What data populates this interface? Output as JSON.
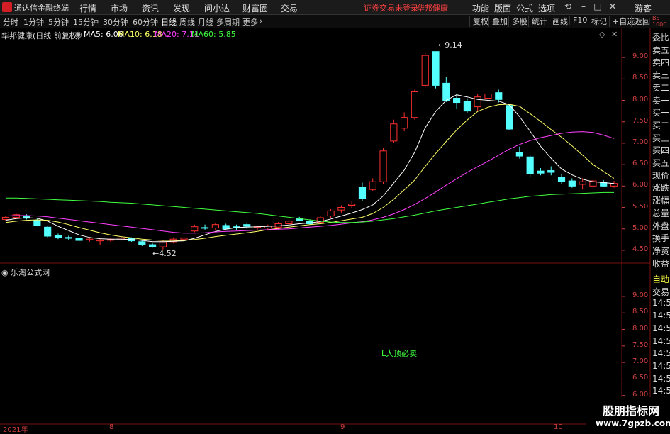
{
  "topbar": {
    "app_title": "通达信金融终端",
    "menu": [
      "行情",
      "市场",
      "资讯",
      "发现",
      "问小达",
      "财富圈",
      "交易"
    ],
    "notice": "证券交易未登录",
    "stock_name_header": "华邦健康",
    "tools": [
      "功能",
      "版面",
      "公式",
      "选项"
    ],
    "user": "游客"
  },
  "periodbar": {
    "periods": [
      "分时",
      "1分钟",
      "5分钟",
      "15分钟",
      "30分钟",
      "60分钟",
      "日线",
      "周线",
      "月线",
      "多周期",
      "更多"
    ],
    "active_period": "日线",
    "right_buttons": [
      "复权",
      "叠加",
      "多股",
      "统计",
      "画线",
      "F10",
      "标记",
      "+自选",
      "返回"
    ]
  },
  "main_chart": {
    "stock_label": "华邦健康(日线 前复权)",
    "ma": [
      {
        "label": "MA5: 6.06",
        "color": "#ffffff"
      },
      {
        "label": "MA10: 6.18",
        "color": "#ffff66"
      },
      {
        "label": "MA20: 7.11",
        "color": "#ff40ff"
      },
      {
        "label": "MA60: 5.85",
        "color": "#40ff40"
      }
    ],
    "high_label": "9.14",
    "low_label": "4.52"
  },
  "sub_chart": {
    "title": "乐淘公式网",
    "signal_text": "L大顶必卖"
  },
  "right_panel_top": [
    "B",
    "S",
    "1000"
  ],
  "right_panel_labels": [
    "委比",
    "卖五",
    "卖四",
    "卖三",
    "卖二",
    "卖一",
    "买一",
    "买二",
    "买三",
    "买四",
    "买五",
    "现价",
    "涨跌",
    "涨幅",
    "总量",
    "外盘",
    "换手",
    "净资",
    "收益"
  ],
  "right_panel_lower": [
    "自动",
    "交易",
    "14:56",
    "14:56",
    "14:56",
    "14:56",
    "14:56",
    "14:56",
    "14:56",
    "14:56",
    "14:56",
    "14:56"
  ],
  "x_labels": [
    "2021年",
    "8",
    "9",
    "10"
  ],
  "watermark": {
    "text": "股朋指标网",
    "url": "www.7gpzb.com"
  },
  "chart_data": [
    {
      "type": "candlestick",
      "title": "华邦健康(日线 前复权)",
      "ylim": [
        4.3,
        9.35
      ],
      "y_ticks": [
        9.0,
        8.5,
        8.0,
        7.5,
        7.0,
        6.5,
        6.0,
        5.5,
        5.0,
        4.5
      ],
      "candles": [
        {
          "o": 5.22,
          "h": 5.3,
          "l": 5.18,
          "c": 5.27
        },
        {
          "o": 5.27,
          "h": 5.36,
          "l": 5.24,
          "c": 5.33
        },
        {
          "o": 5.3,
          "h": 5.34,
          "l": 5.22,
          "c": 5.25
        },
        {
          "o": 5.2,
          "h": 5.25,
          "l": 5.06,
          "c": 5.08
        },
        {
          "o": 5.04,
          "h": 5.08,
          "l": 4.8,
          "c": 4.83
        },
        {
          "o": 4.84,
          "h": 4.89,
          "l": 4.76,
          "c": 4.8
        },
        {
          "o": 4.8,
          "h": 4.84,
          "l": 4.74,
          "c": 4.78
        },
        {
          "o": 4.78,
          "h": 4.82,
          "l": 4.7,
          "c": 4.73
        },
        {
          "o": 4.74,
          "h": 4.78,
          "l": 4.7,
          "c": 4.76
        },
        {
          "o": 4.72,
          "h": 4.76,
          "l": 4.62,
          "c": 4.74
        },
        {
          "o": 4.74,
          "h": 4.79,
          "l": 4.7,
          "c": 4.75
        },
        {
          "o": 4.76,
          "h": 4.82,
          "l": 4.72,
          "c": 4.79
        },
        {
          "o": 4.78,
          "h": 4.8,
          "l": 4.7,
          "c": 4.72
        },
        {
          "o": 4.7,
          "h": 4.74,
          "l": 4.6,
          "c": 4.64
        },
        {
          "o": 4.63,
          "h": 4.66,
          "l": 4.56,
          "c": 4.59
        },
        {
          "o": 4.58,
          "h": 4.72,
          "l": 4.52,
          "c": 4.7
        },
        {
          "o": 4.7,
          "h": 4.8,
          "l": 4.66,
          "c": 4.76
        },
        {
          "o": 4.76,
          "h": 4.84,
          "l": 4.7,
          "c": 4.79
        },
        {
          "o": 4.95,
          "h": 5.1,
          "l": 4.92,
          "c": 5.05
        },
        {
          "o": 5.03,
          "h": 5.1,
          "l": 4.98,
          "c": 5.02
        },
        {
          "o": 5.02,
          "h": 5.14,
          "l": 4.96,
          "c": 5.1
        },
        {
          "o": 5.08,
          "h": 5.12,
          "l": 4.98,
          "c": 5.0
        },
        {
          "o": 5.05,
          "h": 5.1,
          "l": 4.98,
          "c": 5.03
        },
        {
          "o": 5.1,
          "h": 5.14,
          "l": 5.0,
          "c": 5.06
        },
        {
          "o": 5.03,
          "h": 5.08,
          "l": 4.98,
          "c": 5.05
        },
        {
          "o": 5.02,
          "h": 5.1,
          "l": 4.98,
          "c": 5.07
        },
        {
          "o": 5.04,
          "h": 5.16,
          "l": 5.0,
          "c": 5.12
        },
        {
          "o": 5.12,
          "h": 5.22,
          "l": 5.08,
          "c": 5.18
        },
        {
          "o": 5.24,
          "h": 5.28,
          "l": 5.18,
          "c": 5.2
        },
        {
          "o": 5.18,
          "h": 5.22,
          "l": 5.1,
          "c": 5.12
        },
        {
          "o": 5.15,
          "h": 5.3,
          "l": 5.12,
          "c": 5.26
        },
        {
          "o": 5.3,
          "h": 5.46,
          "l": 5.26,
          "c": 5.42
        },
        {
          "o": 5.44,
          "h": 5.55,
          "l": 5.38,
          "c": 5.5
        },
        {
          "o": 5.55,
          "h": 5.64,
          "l": 5.48,
          "c": 5.58
        },
        {
          "o": 5.98,
          "h": 6.08,
          "l": 5.64,
          "c": 5.7
        },
        {
          "o": 5.92,
          "h": 6.18,
          "l": 5.88,
          "c": 6.1
        },
        {
          "o": 6.1,
          "h": 6.9,
          "l": 6.05,
          "c": 6.82
        },
        {
          "o": 7.05,
          "h": 7.55,
          "l": 7.0,
          "c": 7.45
        },
        {
          "o": 7.35,
          "h": 7.72,
          "l": 7.28,
          "c": 7.6
        },
        {
          "o": 7.6,
          "h": 8.25,
          "l": 7.55,
          "c": 8.2
        },
        {
          "o": 8.35,
          "h": 9.1,
          "l": 8.3,
          "c": 9.05
        },
        {
          "o": 9.14,
          "h": 9.14,
          "l": 8.28,
          "c": 8.35
        },
        {
          "o": 8.4,
          "h": 8.55,
          "l": 7.96,
          "c": 8.0
        },
        {
          "o": 8.05,
          "h": 8.15,
          "l": 7.8,
          "c": 7.95
        },
        {
          "o": 7.98,
          "h": 8.05,
          "l": 7.7,
          "c": 7.75
        },
        {
          "o": 7.85,
          "h": 8.15,
          "l": 7.75,
          "c": 8.08
        },
        {
          "o": 8.05,
          "h": 8.28,
          "l": 7.98,
          "c": 8.15
        },
        {
          "o": 8.18,
          "h": 8.25,
          "l": 7.95,
          "c": 8.02
        },
        {
          "o": 7.88,
          "h": 7.9,
          "l": 7.3,
          "c": 7.33
        },
        {
          "o": 6.78,
          "h": 6.92,
          "l": 6.64,
          "c": 6.7
        },
        {
          "o": 6.68,
          "h": 6.72,
          "l": 6.2,
          "c": 6.28
        },
        {
          "o": 6.35,
          "h": 6.42,
          "l": 6.25,
          "c": 6.3
        },
        {
          "o": 6.36,
          "h": 6.46,
          "l": 6.25,
          "c": 6.32
        },
        {
          "o": 6.2,
          "h": 6.28,
          "l": 6.05,
          "c": 6.1
        },
        {
          "o": 6.12,
          "h": 6.18,
          "l": 5.96,
          "c": 6.0
        },
        {
          "o": 6.04,
          "h": 6.18,
          "l": 5.92,
          "c": 6.1
        },
        {
          "o": 6.0,
          "h": 6.15,
          "l": 5.95,
          "c": 6.12
        },
        {
          "o": 6.08,
          "h": 6.14,
          "l": 5.98,
          "c": 6.0
        },
        {
          "o": 6.0,
          "h": 6.12,
          "l": 5.96,
          "c": 6.06
        }
      ],
      "ma_lines": {
        "MA5": [
          5.2,
          5.24,
          5.26,
          5.25,
          5.18,
          5.06,
          4.96,
          4.86,
          4.8,
          4.77,
          4.76,
          4.76,
          4.75,
          4.73,
          4.7,
          4.7,
          4.71,
          4.72,
          4.78,
          4.86,
          4.94,
          4.99,
          5.03,
          5.04,
          5.05,
          5.06,
          5.07,
          5.09,
          5.12,
          5.14,
          5.17,
          5.23,
          5.3,
          5.37,
          5.45,
          5.56,
          5.77,
          6.07,
          6.37,
          6.79,
          7.36,
          7.74,
          8.0,
          8.13,
          8.08,
          8.02,
          8.0,
          7.98,
          7.9,
          7.62,
          7.28,
          6.93,
          6.65,
          6.4,
          6.26,
          6.16,
          6.1,
          6.08,
          6.06
        ],
        "MA10": [
          5.15,
          5.18,
          5.2,
          5.21,
          5.2,
          5.16,
          5.1,
          5.03,
          4.97,
          4.91,
          4.86,
          4.82,
          4.79,
          4.76,
          4.74,
          4.73,
          4.73,
          4.73,
          4.75,
          4.78,
          4.82,
          4.85,
          4.88,
          4.91,
          4.94,
          4.98,
          5.01,
          5.04,
          5.07,
          5.1,
          5.12,
          5.15,
          5.19,
          5.23,
          5.27,
          5.36,
          5.5,
          5.69,
          5.91,
          6.14,
          6.46,
          6.76,
          7.04,
          7.31,
          7.54,
          7.74,
          7.84,
          7.9,
          7.91,
          7.86,
          7.69,
          7.51,
          7.32,
          7.14,
          6.94,
          6.72,
          6.5,
          6.34,
          6.18
        ],
        "MA20": [
          5.3,
          5.31,
          5.31,
          5.3,
          5.28,
          5.25,
          5.22,
          5.19,
          5.16,
          5.13,
          5.1,
          5.07,
          5.04,
          5.01,
          4.98,
          4.95,
          4.92,
          4.9,
          4.9,
          4.91,
          4.93,
          4.94,
          4.95,
          4.96,
          4.97,
          4.98,
          4.99,
          5.0,
          5.02,
          5.04,
          5.06,
          5.08,
          5.11,
          5.14,
          5.17,
          5.21,
          5.27,
          5.35,
          5.45,
          5.57,
          5.71,
          5.86,
          6.02,
          6.17,
          6.32,
          6.45,
          6.58,
          6.72,
          6.86,
          6.97,
          7.06,
          7.13,
          7.18,
          7.23,
          7.26,
          7.27,
          7.25,
          7.19,
          7.11
        ],
        "MA60": [
          5.72,
          5.72,
          5.71,
          5.7,
          5.69,
          5.68,
          5.67,
          5.66,
          5.65,
          5.64,
          5.62,
          5.61,
          5.6,
          5.58,
          5.56,
          5.54,
          5.52,
          5.5,
          5.48,
          5.46,
          5.44,
          5.42,
          5.4,
          5.38,
          5.36,
          5.33,
          5.3,
          5.27,
          5.24,
          5.21,
          5.18,
          5.16,
          5.15,
          5.15,
          5.16,
          5.18,
          5.21,
          5.24,
          5.28,
          5.32,
          5.37,
          5.42,
          5.46,
          5.5,
          5.54,
          5.58,
          5.62,
          5.66,
          5.7,
          5.73,
          5.76,
          5.78,
          5.8,
          5.81,
          5.82,
          5.83,
          5.84,
          5.85,
          5.85
        ]
      }
    },
    {
      "type": "line",
      "title": "乐淘公式网",
      "ylim": [
        5.2,
        9.6
      ],
      "y_ticks": [
        9.0,
        8.5,
        8.0,
        7.5,
        7.0,
        6.5,
        6.0,
        5.5
      ],
      "series": []
    }
  ]
}
